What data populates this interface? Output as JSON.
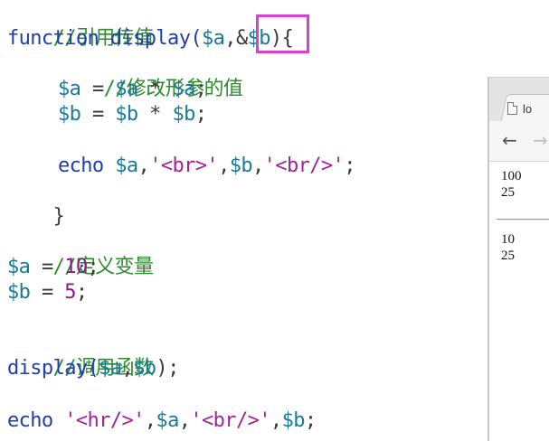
{
  "code": {
    "line1_comment": "//引用传值",
    "line2_kw": "function",
    "line2_fn": " display(",
    "line2_var1": "$a",
    "line2_comma": ",",
    "line2_amp": "&",
    "line2_var2": "$b",
    "line2_close": "){",
    "line3_comment": "//修改形参的值",
    "line4": {
      "v1": "$a",
      "op1": " = ",
      "v2": "$a",
      "op2": " * ",
      "v3": "$a",
      "end": ";"
    },
    "line5": {
      "v1": "$b",
      "op1": " = ",
      "v2": "$b",
      "op2": " * ",
      "v3": "$b",
      "end": ";"
    },
    "line7": {
      "kw": "echo ",
      "v1": "$a",
      "c1": ",",
      "s1": "'<br>'",
      "c2": ",",
      "v2": "$b",
      "c3": ",",
      "s2": "'<br/>'",
      "end": ";"
    },
    "line8": "}",
    "line10_comment": "//定义变量",
    "line11": {
      "v": "$a",
      "op": " = ",
      "num": "10",
      "end": ";"
    },
    "line12": {
      "v": "$b",
      "op": " = ",
      "num": "5",
      "end": ";"
    },
    "line14_comment": "//调用函数",
    "line15": {
      "fn": "display(",
      "v1": "$a",
      "c": ",",
      "v2": "$b",
      "end": ");"
    },
    "line17": {
      "kw": "echo ",
      "s1": "'<hr/>'",
      "c1": ",",
      "v1": "$a",
      "c2": ",",
      "s2": "'<br/>'",
      "c3": ",",
      "v2": "$b",
      "end": ";"
    }
  },
  "browser": {
    "tab_title": "lo",
    "back_icon": "←",
    "forward_icon": "→",
    "output_top": [
      "100",
      "25"
    ],
    "output_bottom": [
      "10",
      "25"
    ]
  },
  "colors": {
    "highlight": "#d93fd0",
    "comment": "#2e8b2e",
    "keyword": "#1f3fae",
    "string": "#a3229b"
  }
}
